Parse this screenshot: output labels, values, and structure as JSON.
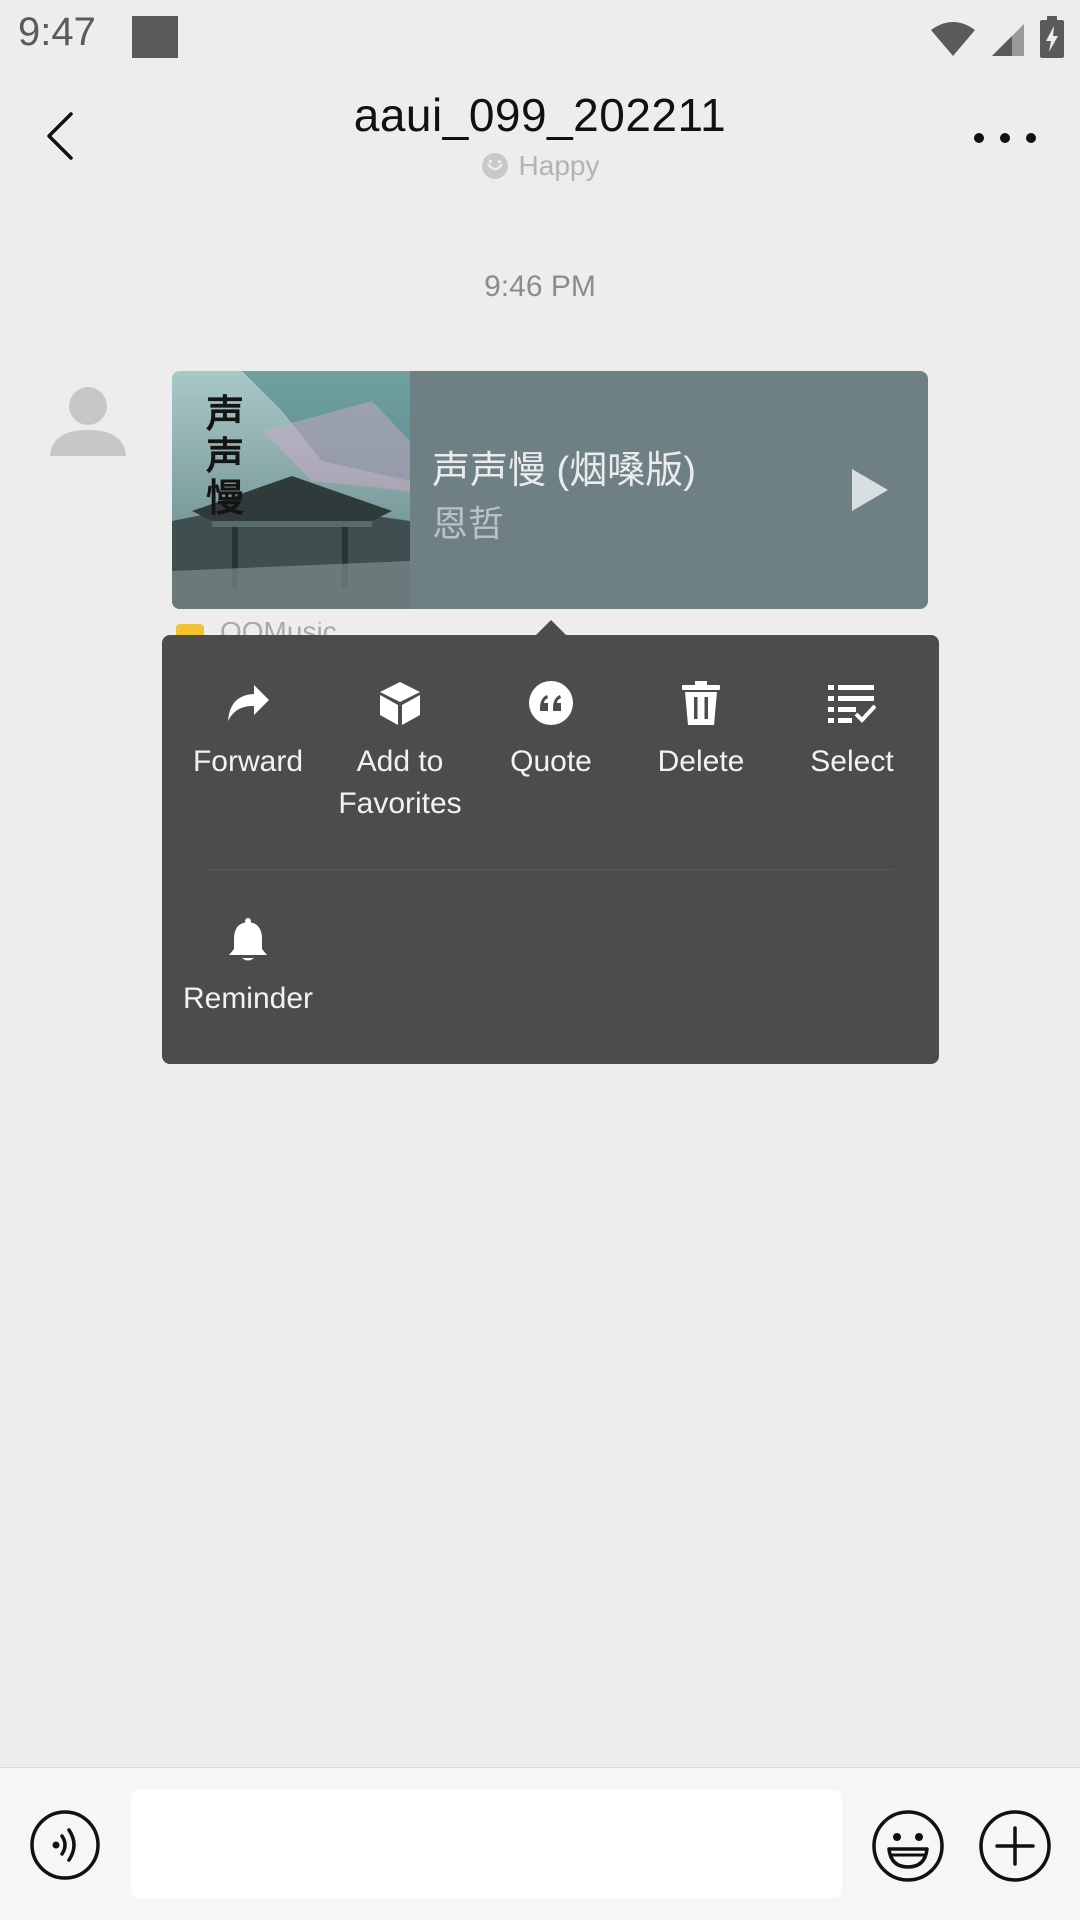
{
  "status_bar": {
    "time": "9:47",
    "icons": [
      "wifi-icon",
      "cell-signal-icon",
      "battery-charging-icon"
    ]
  },
  "header": {
    "title": "aaui_099_202211",
    "status_icon": "smiley-status-icon",
    "status_text": "Happy",
    "back_icon": "chevron-left-icon",
    "more_icon": "more-dots-icon"
  },
  "chat": {
    "timestamp": "9:46 PM",
    "message": {
      "type": "music-card",
      "song_title": "声声慢 (烟嗓版)",
      "artist": "恩哲",
      "cover_calligraphy": "声声慢",
      "source_label": "QQMusic",
      "card_color": "#6f8084"
    }
  },
  "context_menu": {
    "items": [
      {
        "label": "Forward",
        "icon": "forward-icon"
      },
      {
        "label": "Add to\nFavorites",
        "icon": "cube-favorites-icon"
      },
      {
        "label": "Quote",
        "icon": "quote-icon"
      },
      {
        "label": "Delete",
        "icon": "trash-icon"
      },
      {
        "label": "Select",
        "icon": "select-list-icon"
      },
      {
        "label": "Reminder",
        "icon": "bell-icon"
      }
    ],
    "background": "#4c4c4c"
  },
  "input_bar": {
    "voice_icon": "voice-icon",
    "input_value": "",
    "emoji_icon": "emoji-icon",
    "plus_icon": "plus-circle-icon"
  }
}
